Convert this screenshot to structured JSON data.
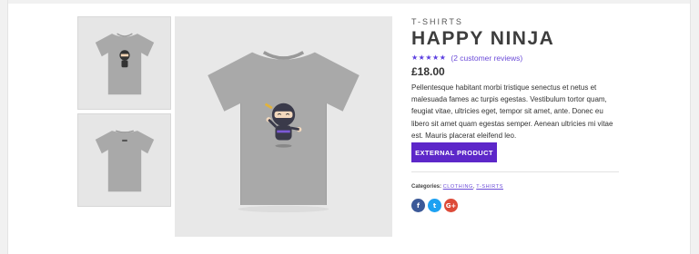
{
  "product": {
    "category": "T-SHIRTS",
    "title": "HAPPY NINJA",
    "rating": 5,
    "reviews_text": "(2 customer reviews)",
    "price": "£18.00",
    "description": "Pellentesque habitant morbi tristique senectus et netus et malesuada fames ac turpis egestas. Vestibulum tortor quam, feugiat vitae, ultricies eget, tempor sit amet, ante. Donec eu libero sit amet quam egestas semper. Aenean ultricies mi vitae est. Mauris placerat eleifend leo.",
    "button_label": "EXTERNAL PRODUCT",
    "categories_label": "Categories:",
    "categories": [
      "CLOTHING",
      "T-SHIRTS"
    ],
    "categories_separator": ","
  },
  "social": {
    "facebook": "f",
    "twitter": "t",
    "googleplus": "G+"
  },
  "colors": {
    "accent": "#5d27c9",
    "link": "#6b4bd8",
    "facebook": "#3b5998",
    "twitter": "#1da1f2",
    "googleplus": "#dd4b39",
    "shirt": "#a9a9a9"
  },
  "icons": {
    "star": "★",
    "facebook": "facebook-icon",
    "twitter": "twitter-icon",
    "googleplus": "google-plus-icon"
  }
}
